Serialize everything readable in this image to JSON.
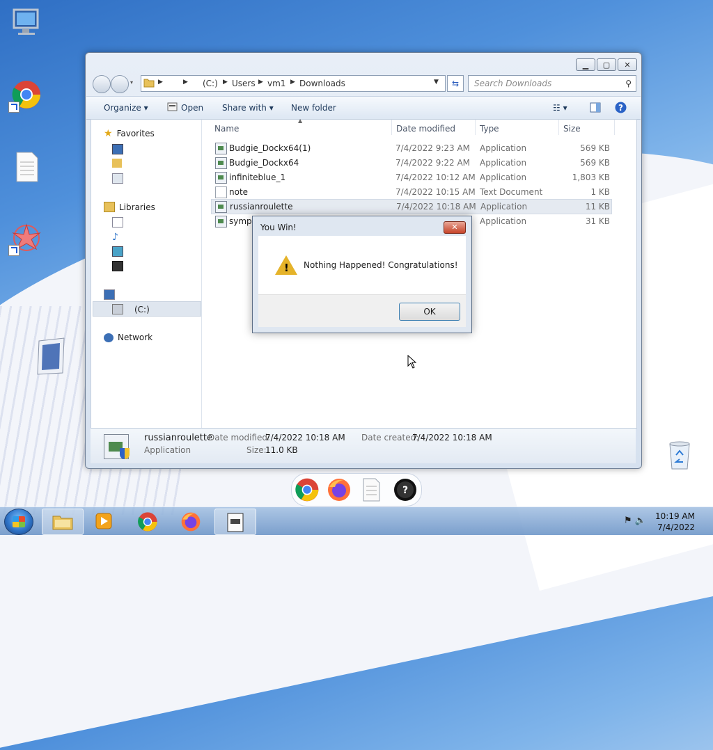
{
  "desktop": {
    "icons": [
      "computer-icon",
      "chrome-icon",
      "text-file-icon",
      "app-star-icon",
      "window-frame-icon",
      "recycle-bin-icon"
    ]
  },
  "explorer": {
    "address": {
      "drive": "(C:)",
      "path1": "Users",
      "path2": "vm1",
      "path3": "Downloads"
    },
    "search_placeholder": "Search Downloads",
    "toolbar": {
      "organize": "Organize ▾",
      "open": "Open",
      "share": "Share with ▾",
      "new_folder": "New folder"
    },
    "nav": {
      "favorites": "Favorites",
      "libraries": "Libraries",
      "drive": "(C:)",
      "network": "Network"
    },
    "columns": {
      "name": "Name",
      "date": "Date modified",
      "type": "Type",
      "size": "Size"
    },
    "files": [
      {
        "name": "Budgie_Dockx64(1)",
        "date": "7/4/2022 9:23 AM",
        "type": "Application",
        "size": "569 KB"
      },
      {
        "name": "Budgie_Dockx64",
        "date": "7/4/2022 9:22 AM",
        "type": "Application",
        "size": "569 KB"
      },
      {
        "name": "infiniteblue_1",
        "date": "7/4/2022 10:12 AM",
        "type": "Application",
        "size": "1,803 KB"
      },
      {
        "name": "note",
        "date": "7/4/2022 10:15 AM",
        "type": "Text Document",
        "size": "1 KB"
      },
      {
        "name": "russianroulette",
        "date": "7/4/2022 10:18 AM",
        "type": "Application",
        "size": "11 KB"
      },
      {
        "name": "symph",
        "date": "",
        "type": "Application",
        "size": "31 KB"
      }
    ],
    "details": {
      "name": "russianroulette",
      "type": "Application",
      "modified_label": "Date modified:",
      "modified": "7/4/2022 10:18 AM",
      "created_label": "Date created:",
      "created": "7/4/2022 10:18 AM",
      "size_label": "Size:",
      "size": "11.0 KB"
    }
  },
  "dialog": {
    "title": "You Win!",
    "message": "Nothing Happened! Congratulations!",
    "ok": "OK",
    "close": "✕"
  },
  "taskbar": {
    "time": "10:19 AM",
    "date": "7/4/2022"
  }
}
